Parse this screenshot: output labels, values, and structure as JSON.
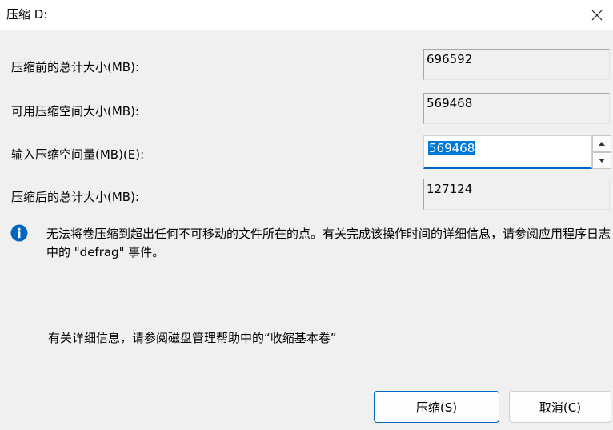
{
  "window": {
    "title": "压缩 D:"
  },
  "fields": {
    "total_before_label": "压缩前的总计大小(MB):",
    "total_before_value": "696592",
    "available_label": "可用压缩空间大小(MB):",
    "available_value": "569468",
    "shrink_amount_label": "输入压缩空间量(MB)(E):",
    "shrink_amount_value": "569468",
    "total_after_label": "压缩后的总计大小(MB):",
    "total_after_value": "127124"
  },
  "info": {
    "message": "无法将卷压缩到超出任何不可移动的文件所在的点。有关完成该操作时间的详细信息，请参阅应用程序日志中的 \"defrag\" 事件。",
    "more_info": "有关详细信息，请参阅磁盘管理帮助中的“收缩基本卷”"
  },
  "buttons": {
    "shrink": "压缩(S)",
    "cancel": "取消(C)"
  },
  "colors": {
    "accent": "#0067c0",
    "selection": "#0078d7",
    "info_icon": "#0067c0"
  }
}
